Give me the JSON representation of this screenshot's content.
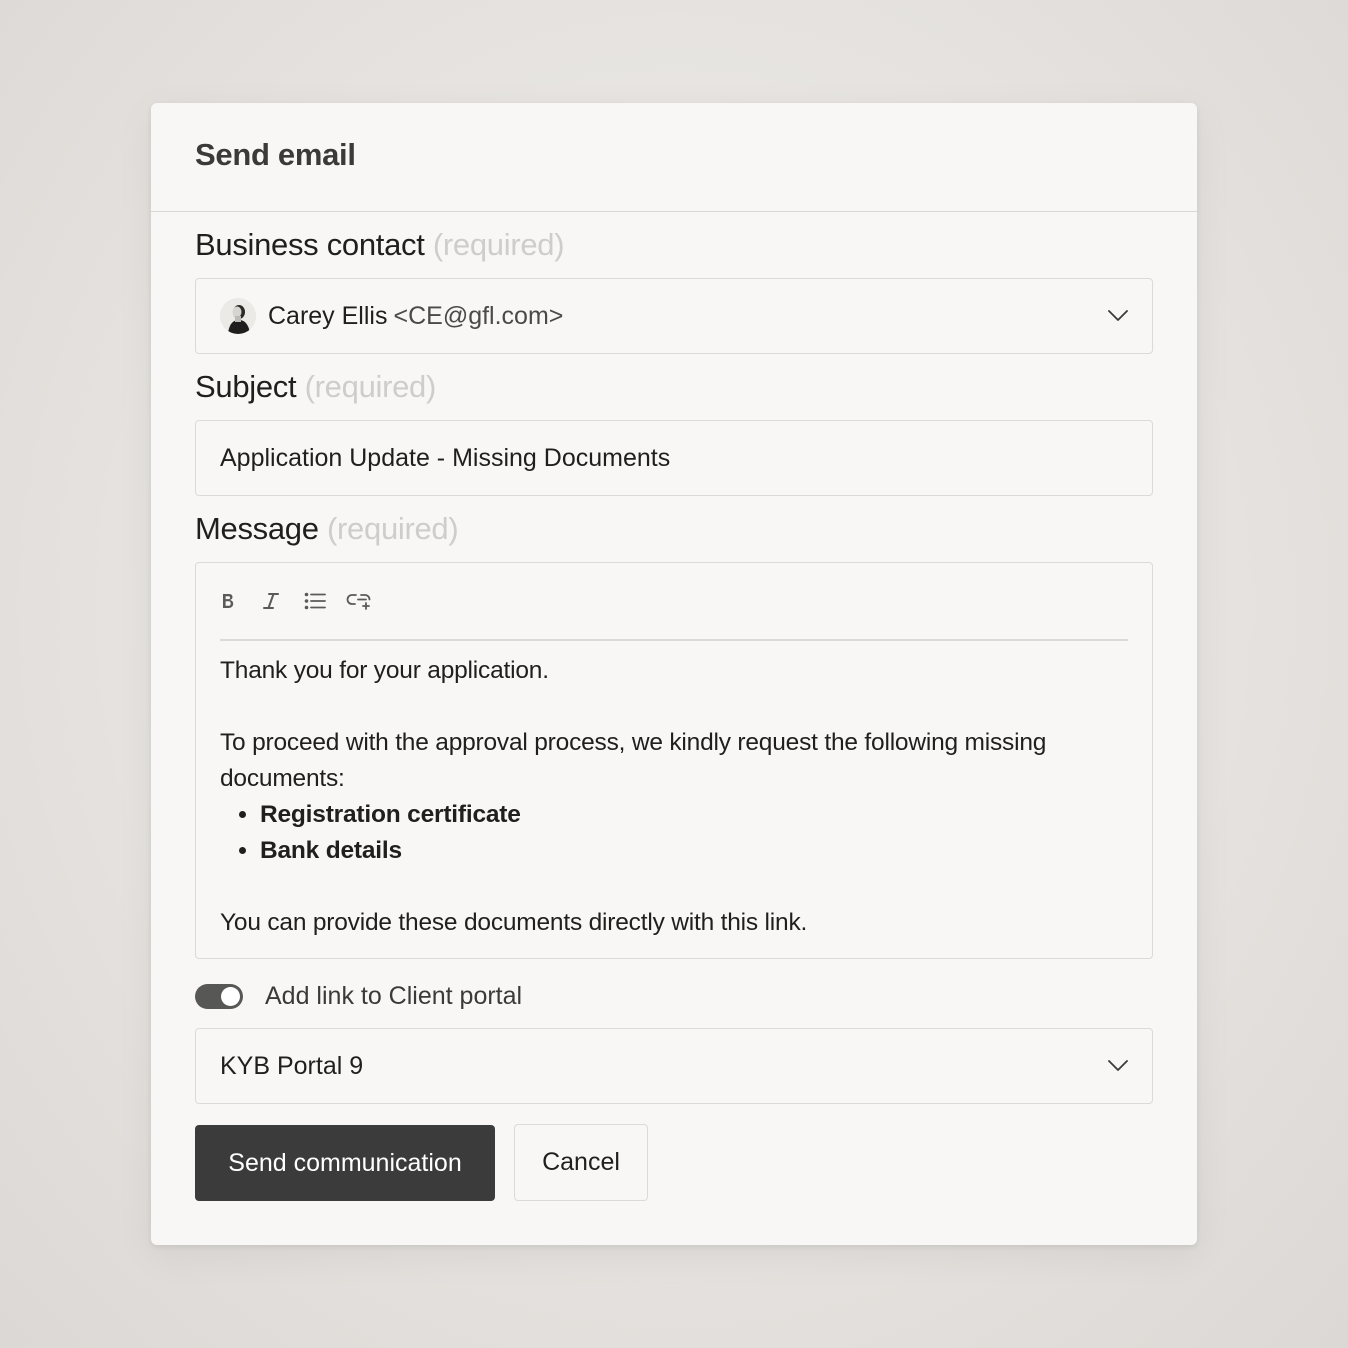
{
  "dialog": {
    "title": "Send email"
  },
  "business_contact": {
    "label": "Business contact",
    "required_hint": "(required)",
    "name": "Carey Ellis",
    "email": "<CE@gfl.com>",
    "avatar_icon": "person-avatar"
  },
  "subject": {
    "label": "Subject",
    "required_hint": "(required)",
    "value": "Application Update - Missing Documents"
  },
  "message": {
    "label": "Message",
    "required_hint": "(required)",
    "toolbar": [
      "bold-icon",
      "italic-icon",
      "bullet-list-icon",
      "link-icon"
    ],
    "paragraph_1": "Thank you for your application.",
    "paragraph_2": "To proceed with the approval process, we kindly request the following missing documents:",
    "bullets": [
      "Registration certificate",
      "Bank details"
    ],
    "paragraph_3": "You can provide these documents directly with this link."
  },
  "portal_toggle": {
    "label": "Add link to Client portal",
    "enabled": true
  },
  "portal_select": {
    "value": "KYB Portal 9"
  },
  "actions": {
    "send_label": "Send communication",
    "cancel_label": "Cancel"
  },
  "colors": {
    "primary_button": "#3b3b3b",
    "toggle_on": "#575856",
    "required_hint": "#cfcdcb"
  }
}
